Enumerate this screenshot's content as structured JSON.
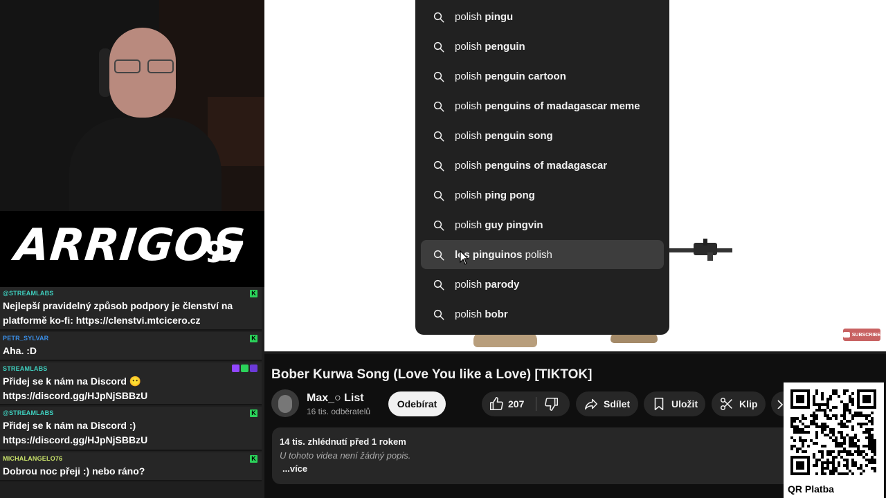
{
  "stream": {
    "logo_text": "ARRIGOS",
    "logo_number": "97"
  },
  "chat": [
    {
      "user": "@STREAMLABS",
      "user_color": "#3fd1c0",
      "text": "Nejlepší pravidelný způsob podpory je členství na platformě ko-fi: https://clenstvi.mtcicero.cz",
      "badge": "K"
    },
    {
      "user": "PETR_SYLVAR",
      "user_color": "#3a8ee6",
      "text": "Aha. :D",
      "badge": "K"
    },
    {
      "user": "STREAMLABS",
      "user_color": "#3fd1c0",
      "text": "Přidej se k nám na Discord 😶 https://discord.gg/HJpNjSBBzU",
      "badge": ""
    },
    {
      "user": "@STREAMLABS",
      "user_color": "#3fd1c0",
      "text": "Přidej se k nám na Discord :) https://discord.gg/HJpNjSBBzU",
      "badge": "K"
    },
    {
      "user": "MICHALANGELO76",
      "user_color": "#c9e26a",
      "text": "Dobrou noc přeji :) nebo ráno?",
      "badge": "K"
    }
  ],
  "suggestions": [
    {
      "prefix": "polish ",
      "bold": "pingu",
      "suffix": ""
    },
    {
      "prefix": "polish ",
      "bold": "penguin",
      "suffix": ""
    },
    {
      "prefix": "polish ",
      "bold": "penguin cartoon",
      "suffix": ""
    },
    {
      "prefix": "polish ",
      "bold": "penguins of madagascar meme",
      "suffix": ""
    },
    {
      "prefix": "polish ",
      "bold": "penguin song",
      "suffix": ""
    },
    {
      "prefix": "polish ",
      "bold": "penguins of madagascar",
      "suffix": ""
    },
    {
      "prefix": "polish ",
      "bold": "ping pong",
      "suffix": ""
    },
    {
      "prefix": "polish ",
      "bold": "guy pingvin",
      "suffix": ""
    },
    {
      "prefix": "",
      "bold": "los pinguinos",
      "suffix": " polish"
    },
    {
      "prefix": "polish ",
      "bold": "parody",
      "suffix": ""
    },
    {
      "prefix": "polish ",
      "bold": "bobr",
      "suffix": ""
    }
  ],
  "video": {
    "title": "Bober Kurwa Song (Love You like a Love) [TIKTOK]",
    "watermark": "SUBSCRIBE",
    "channel_name": "Max_○ List",
    "channel_subs": "16 tis. odběratelů",
    "subscribe_label": "Odebírat",
    "like_count": "207",
    "share_label": "Sdílet",
    "save_label": "Uložit",
    "clip_label": "Klip",
    "views_meta": "14 tis. zhlédnutí  před 1 rokem",
    "description": "U tohoto videa není žádný popis.",
    "more_label": "...více"
  },
  "qr": {
    "label": "QR Platba"
  },
  "colors": {
    "yt_bg": "#0f0f0f",
    "pill_bg": "#272727",
    "dropdown_bg": "#212121",
    "kick_green": "#2bd25a"
  }
}
